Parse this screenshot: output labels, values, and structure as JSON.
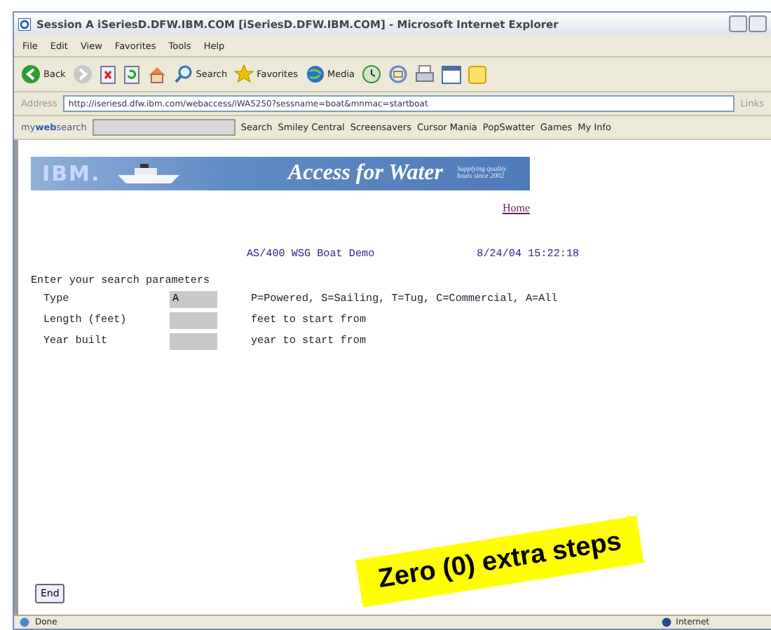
{
  "window": {
    "title": "Session A iSeriesD.DFW.IBM.COM [iSeriesD.DFW.IBM.COM] - Microsoft Internet Explorer"
  },
  "menu": [
    "File",
    "Edit",
    "View",
    "Favorites",
    "Tools",
    "Help"
  ],
  "toolbar": [
    {
      "kind": "back",
      "label": "Back"
    },
    {
      "kind": "forward"
    },
    {
      "kind": "stop"
    },
    {
      "kind": "refresh"
    },
    {
      "kind": "home"
    },
    {
      "kind": "search",
      "label": "Search"
    },
    {
      "kind": "favorites",
      "label": "Favorites"
    },
    {
      "kind": "media",
      "label": "Media"
    },
    {
      "kind": "history"
    },
    {
      "kind": "mail"
    },
    {
      "kind": "print"
    },
    {
      "kind": "edit"
    },
    {
      "kind": "note"
    }
  ],
  "address": {
    "label": "Address",
    "value": "http://iseriesd.dfw.ibm.com/webaccess/iWA5250?sessname=boat&mnmac=startboat",
    "links": "Links"
  },
  "websearch": {
    "logo_my": "my",
    "logo_web": "web",
    "logo_search": "search",
    "button": "Search",
    "links": [
      "Smiley Central",
      "Screensavers",
      "Cursor Mania",
      "PopSwatter",
      "Games",
      "My Info"
    ]
  },
  "banner": {
    "logo": "IBM.",
    "title": "Access for Water",
    "tagline": "Supplying quality boats since 2002"
  },
  "home_link": "Home",
  "screen_title": "AS/400 WSG Boat Demo",
  "timestamp": "8/24/04 15:22:18",
  "prompt": "Enter your search parameters",
  "fields": [
    {
      "label": "Type",
      "value": "A",
      "hint": "P=Powered, S=Sailing, T=Tug, C=Commercial, A=All"
    },
    {
      "label": "Length (feet)",
      "hint": "feet to start from"
    },
    {
      "label": "Year built",
      "hint": "year to start from"
    }
  ],
  "end_button": "End",
  "status": {
    "text": "Done",
    "zone": "Internet"
  },
  "callout": "Zero (0) extra steps"
}
